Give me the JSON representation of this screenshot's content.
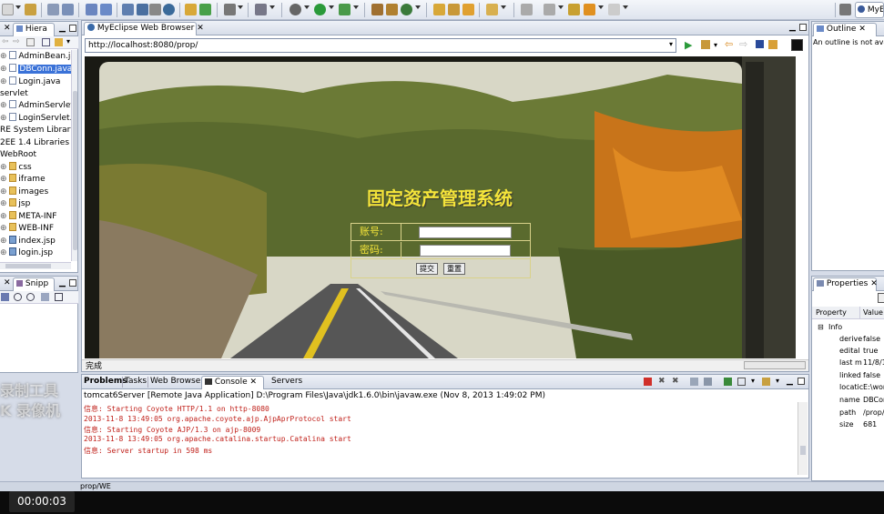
{
  "window": {
    "perspective": "MyE"
  },
  "hierarchy": {
    "tab": "Hiera",
    "items": [
      {
        "label": "AdminBean.ja",
        "icon": "java"
      },
      {
        "label": "DBConn.java",
        "icon": "java"
      },
      {
        "label": "Login.java",
        "icon": "java"
      },
      {
        "label": "servlet",
        "icon": "package"
      },
      {
        "label": "AdminServlet",
        "icon": "java"
      },
      {
        "label": "LoginServlet.j",
        "icon": "java"
      },
      {
        "label": "RE System Library",
        "icon": "library"
      },
      {
        "label": "2EE 1.4 Libraries",
        "icon": "library"
      },
      {
        "label": "WebRoot",
        "icon": "folder"
      },
      {
        "label": "css",
        "icon": "folder"
      },
      {
        "label": "iframe",
        "icon": "folder"
      },
      {
        "label": "images",
        "icon": "folder"
      },
      {
        "label": "jsp",
        "icon": "folder"
      },
      {
        "label": "META-INF",
        "icon": "folder"
      },
      {
        "label": "WEB-INF",
        "icon": "folder"
      },
      {
        "label": "index.jsp",
        "icon": "jsp"
      },
      {
        "label": "login.jsp",
        "icon": "jsp"
      }
    ]
  },
  "snippets": {
    "tab": "Snipp"
  },
  "browser": {
    "tab": "MyEclipse Web Browser",
    "url": "http://localhost:8080/prop/",
    "status": "完成",
    "page": {
      "title": "固定资产管理系统",
      "account_label": "账号:",
      "password_label": "密码:",
      "submit_label": "提交",
      "reset_label": "重置"
    }
  },
  "console": {
    "tabs": [
      "Problems",
      "Tasks",
      "Web Browser",
      "Console",
      "Servers"
    ],
    "active_tab": "Console",
    "header": "tomcat6Server [Remote Java Application] D:\\Program Files\\Java\\jdk1.6.0\\bin\\javaw.exe (Nov 8, 2013 1:49:02 PM)",
    "lines": [
      "信息: Starting Coyote HTTP/1.1 on http-8080",
      "2013-11-8 13:49:05 org.apache.coyote.ajp.AjpAprProtocol start",
      "信息: Starting Coyote AJP/1.3 on ajp-8009",
      "2013-11-8 13:49:05 org.apache.catalina.startup.Catalina start",
      "信息: Server startup in 598 ms"
    ],
    "bottom_fragment": "prop/WE"
  },
  "outline": {
    "tab": "Outline",
    "message": "An outline is not ava"
  },
  "properties": {
    "tab": "Properties",
    "col_property": "Property",
    "col_value": "Value",
    "group": "Info",
    "rows": [
      {
        "name": "derive",
        "value": "false"
      },
      {
        "name": "edital",
        "value": "true"
      },
      {
        "name": "last m",
        "value": "11/8/1"
      },
      {
        "name": "linked",
        "value": "false"
      },
      {
        "name": "locatic",
        "value": "E:\\wor"
      },
      {
        "name": "name",
        "value": "DBCon"
      },
      {
        "name": "path",
        "value": "/prop/"
      },
      {
        "name": "size",
        "value": "681"
      }
    ]
  },
  "watermark": {
    "line1": "录制工具",
    "line2": "K 录像机"
  },
  "player": {
    "time": "00:00:03"
  }
}
